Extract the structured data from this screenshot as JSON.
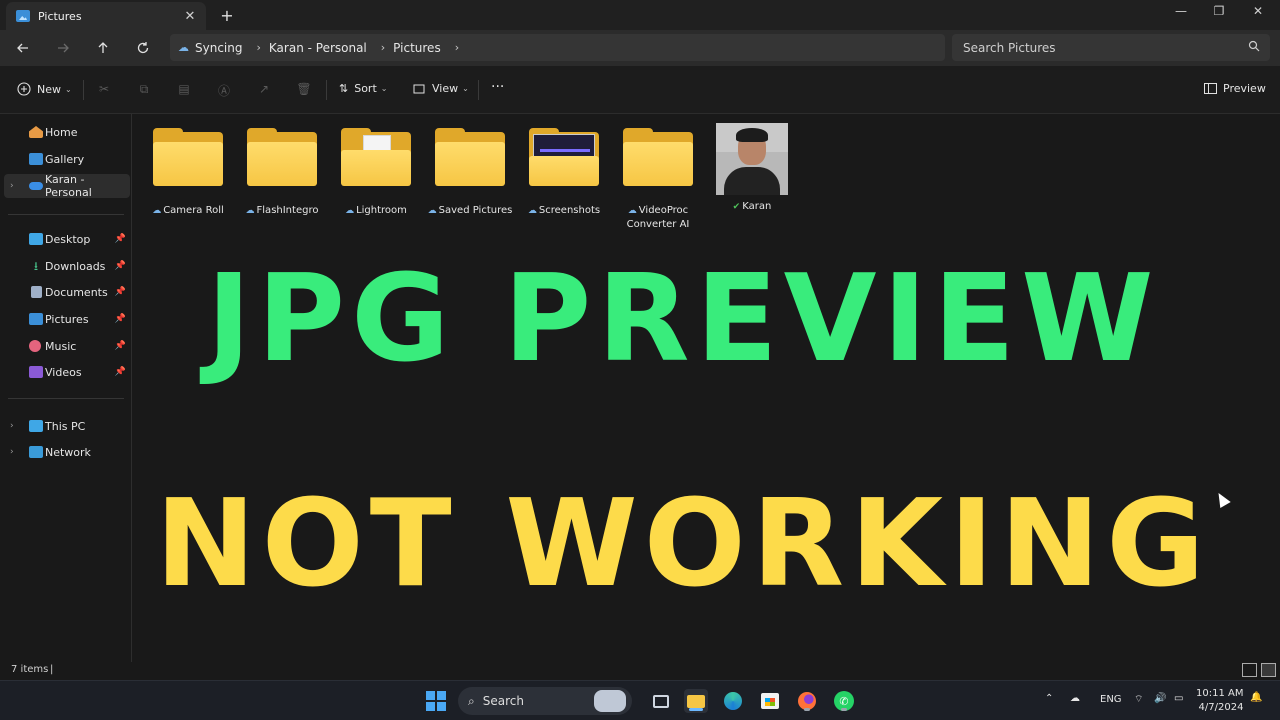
{
  "window": {
    "tab_title": "Pictures",
    "tab_close": "✕",
    "new_tab": "+",
    "minimize": "—",
    "restore": "❐",
    "close": "✕"
  },
  "nav": {
    "back_icon": "arrow-left-icon",
    "forward_icon": "arrow-right-icon",
    "up_icon": "arrow-up-icon",
    "refresh_icon": "refresh-icon",
    "breadcrumbs": [
      "Syncing",
      "Karan - Personal",
      "Pictures"
    ],
    "search_placeholder": "Search Pictures"
  },
  "commandbar": {
    "new_label": "New",
    "sort_label": "Sort",
    "view_label": "View",
    "more_label": "···",
    "preview_label": "Preview"
  },
  "sidebar": {
    "quick": [
      {
        "label": "Home",
        "icon": "home-icon"
      },
      {
        "label": "Gallery",
        "icon": "gallery-icon"
      },
      {
        "label": "Karan - Personal",
        "icon": "onedrive-icon"
      }
    ],
    "pinned": [
      {
        "label": "Desktop",
        "icon": "desktop-icon"
      },
      {
        "label": "Downloads",
        "icon": "downloads-icon"
      },
      {
        "label": "Documents",
        "icon": "documents-icon"
      },
      {
        "label": "Pictures",
        "icon": "pictures-icon"
      },
      {
        "label": "Music",
        "icon": "music-icon"
      },
      {
        "label": "Videos",
        "icon": "videos-icon"
      }
    ],
    "devices": [
      {
        "label": "This PC",
        "icon": "this-pc-icon"
      },
      {
        "label": "Network",
        "icon": "network-icon"
      }
    ]
  },
  "files": [
    {
      "name": "Camera Roll",
      "type": "folder",
      "sync": "cloud"
    },
    {
      "name": "FlashIntegro",
      "type": "folder",
      "sync": "cloud"
    },
    {
      "name": "Lightroom",
      "type": "folder-with-file",
      "sync": "cloud"
    },
    {
      "name": "Saved Pictures",
      "type": "folder",
      "sync": "cloud"
    },
    {
      "name": "Screenshots",
      "type": "folder-with-screenshot",
      "sync": "cloud"
    },
    {
      "name": "VideoProc Converter AI",
      "type": "folder",
      "sync": "cloud"
    },
    {
      "name": "Karan",
      "type": "photo",
      "sync": "synced"
    }
  ],
  "overlay": {
    "line1": "JPG PREVIEW",
    "line2": "NOT WORKING",
    "line1_color": "#39ec7c",
    "line2_color": "#fddb4a"
  },
  "status": {
    "item_count": "7 items"
  },
  "taskbar": {
    "search_label": "Search",
    "lang": "ENG",
    "time": "10:11 AM",
    "date": "4/7/2024"
  }
}
